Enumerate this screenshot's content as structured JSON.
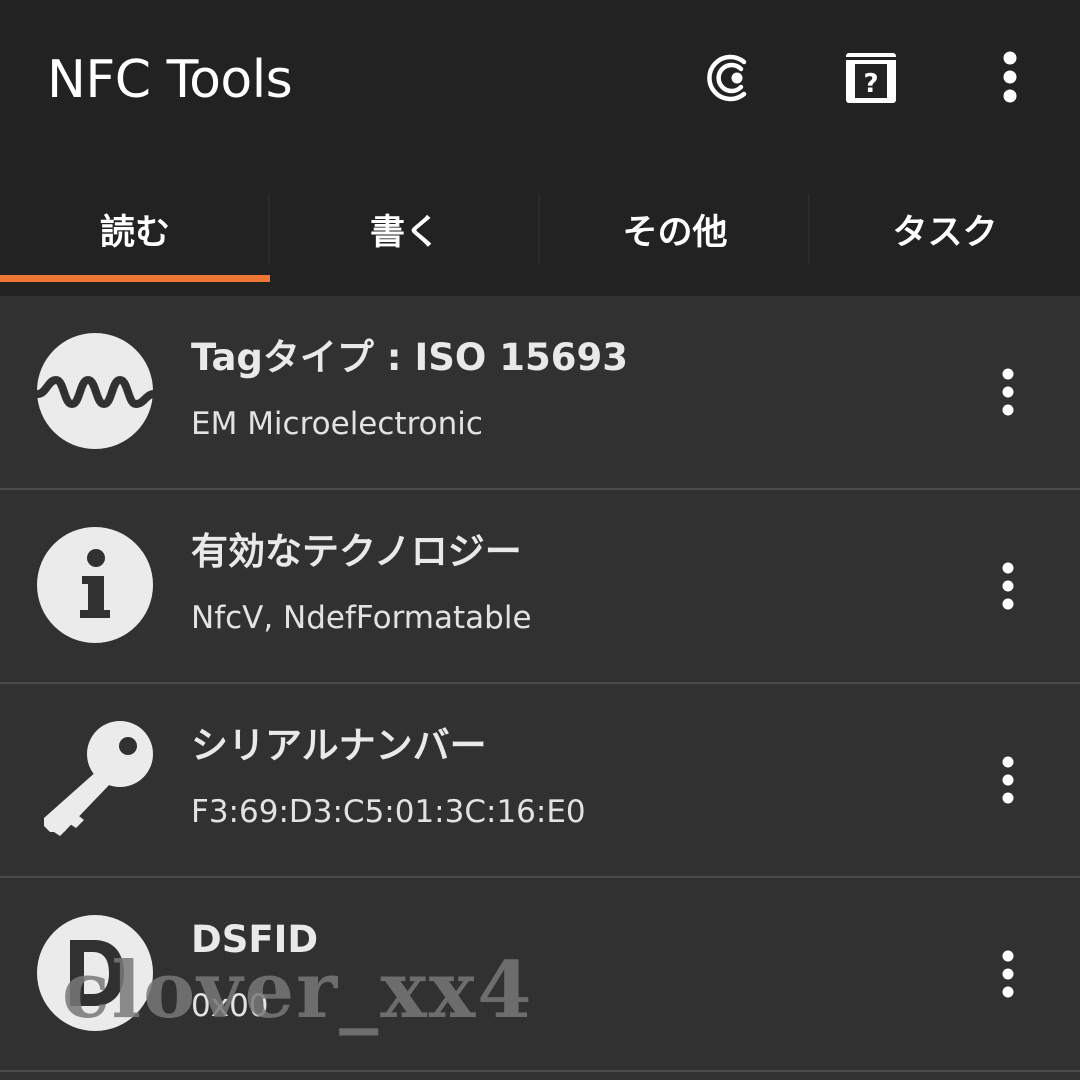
{
  "appbar": {
    "title": "NFC Tools",
    "icons": [
      "nfc-scan-icon",
      "help-book-icon",
      "overflow-menu-icon"
    ]
  },
  "tabs": [
    {
      "label": "読む",
      "selected": true
    },
    {
      "label": "書く",
      "selected": false
    },
    {
      "label": "その他",
      "selected": false
    },
    {
      "label": "タスク",
      "selected": false
    }
  ],
  "rows": [
    {
      "icon": "wave-icon",
      "title": "Tagタイプ : ISO 15693",
      "subtitle": "EM Microelectronic"
    },
    {
      "icon": "info-icon",
      "title": "有効なテクノロジー",
      "subtitle": "NfcV, NdefFormatable"
    },
    {
      "icon": "key-icon",
      "title": "シリアルナンバー",
      "subtitle": "F3:69:D3:C5:01:3C:16:E0"
    },
    {
      "icon": "letter-d-icon",
      "title": "DSFID",
      "subtitle": "0x00"
    }
  ],
  "watermark": "clover_xx4",
  "colors": {
    "appbar_bg": "#222222",
    "list_bg": "#313131",
    "accent": "#ee7737",
    "icon_fill": "#ebebeb"
  }
}
